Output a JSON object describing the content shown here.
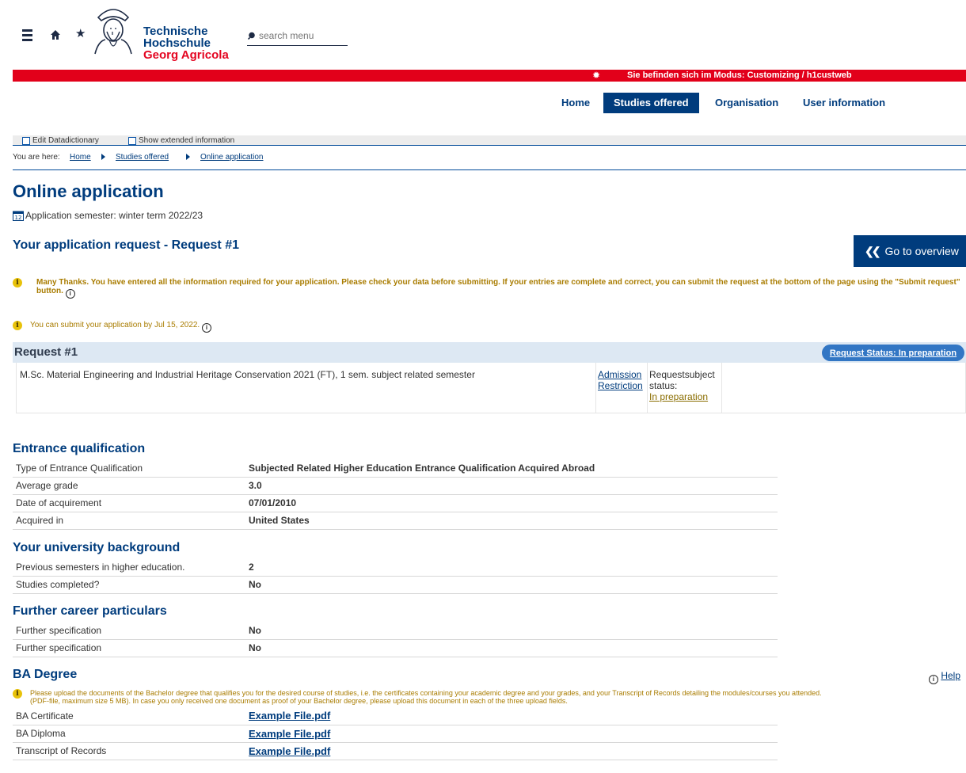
{
  "header": {
    "logo_line1": "Technische",
    "logo_line2": "Hochschule",
    "logo_line3": "Georg Agricola",
    "search_placeholder": "search menu",
    "mode_text": "Sie befinden sich im Modus: Customizing / h1custweb"
  },
  "nav": {
    "items": [
      "Home",
      "Studies offered",
      "Organisation",
      "User information"
    ]
  },
  "toolbar": {
    "edit_datadictionary": "Edit Datadictionary",
    "show_extended": "Show extended information"
  },
  "breadcrumb": {
    "prefix": "You are here:",
    "items": [
      "Home",
      "Studies offered",
      "Online application"
    ]
  },
  "page": {
    "title": "Online application",
    "semester": "Application semester: winter term 2022/23",
    "request_heading": "Your application request - Request #1",
    "goto_overview": "Go to overview",
    "info1": "Many Thanks. You have entered all the information required for your application. Please check your data before submitting. If your entries are complete and correct, you can submit the request at the bottom of the page using the \"Submit request\" button.",
    "info2": "You can submit your application by Jul 15, 2022."
  },
  "request": {
    "title": "Request #1",
    "status_button": "Request Status: In preparation",
    "course": "M.Sc. Material Engineering and Industrial Heritage Conservation 2021 (FT), 1 sem. subject related semester",
    "admission_line1": "Admission",
    "admission_line2": "Restriction",
    "status_label_line1": "Requestsubject",
    "status_label_line2": "status:",
    "status_value": "In preparation"
  },
  "entrance": {
    "heading": "Entrance qualification",
    "rows": [
      {
        "label": "Type of Entrance Qualification",
        "value": "Subjected Related Higher Education Entrance Qualification Acquired Abroad"
      },
      {
        "label": "Average grade",
        "value": "3.0"
      },
      {
        "label": "Date of acquirement",
        "value": "07/01/2010"
      },
      {
        "label": "Acquired in",
        "value": "United States"
      }
    ]
  },
  "university": {
    "heading": "Your university background",
    "rows": [
      {
        "label": "Previous semesters in higher education.",
        "value": "2"
      },
      {
        "label": "Studies completed?",
        "value": "No"
      }
    ]
  },
  "career": {
    "heading": "Further career particulars",
    "rows": [
      {
        "label": "Further specification",
        "value": "No"
      },
      {
        "label": "Further specification",
        "value": "No"
      }
    ]
  },
  "ba": {
    "heading": "BA Degree",
    "help": "Help",
    "info_line1": "Please upload the documents of the Bachelor degree that qualifies you for the desired course of studies, i.e. the certificates containing your academic degree and your grades, and your Transcript of Records detailing the modules/courses you attended.",
    "info_line2": "(PDF-file, maximum size 5 MB). In case you only received one document as proof of your Bachelor degree, please upload this document in each of the three upload fields.",
    "rows": [
      {
        "label": "BA Certificate",
        "value": "Example File.pdf"
      },
      {
        "label": "BA Diploma",
        "value": "Example File.pdf"
      },
      {
        "label": "Transcript of Records",
        "value": "Example File.pdf"
      }
    ]
  }
}
